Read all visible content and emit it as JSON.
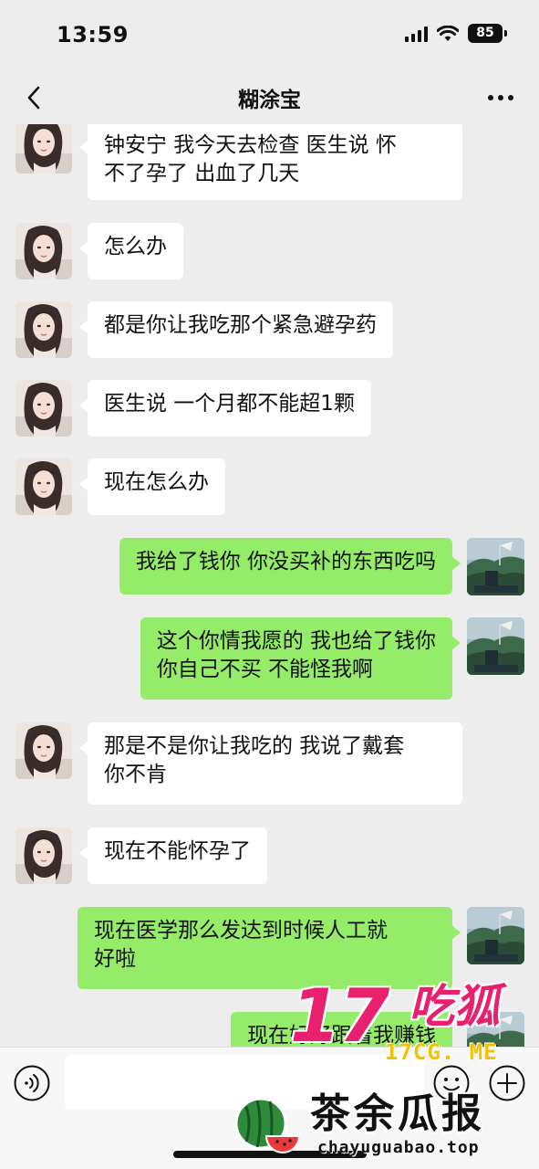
{
  "status_bar": {
    "time": "13:59",
    "battery": "85"
  },
  "chat": {
    "title": "糊涂宝"
  },
  "messages": [
    {
      "side": "left",
      "lines": [
        "钟安宁 我今天去检查 医生说 怀",
        "不了孕了 出血了几天"
      ]
    },
    {
      "side": "left",
      "lines": [
        "怎么办"
      ]
    },
    {
      "side": "left",
      "lines": [
        "都是你让我吃那个紧急避孕药"
      ]
    },
    {
      "side": "left",
      "lines": [
        "医生说 一个月都不能超1颗"
      ]
    },
    {
      "side": "left",
      "lines": [
        "现在怎么办"
      ]
    },
    {
      "side": "right",
      "lines": [
        "我给了钱你 你没买补的东西吃吗"
      ]
    },
    {
      "side": "right",
      "lines": [
        "这个你情我愿的 我也给了钱你",
        "你自己不买 不能怪我啊"
      ]
    },
    {
      "side": "left",
      "lines": [
        "那是不是你让我吃的 我说了戴套",
        "你不肯"
      ]
    },
    {
      "side": "left",
      "lines": [
        "现在不能怀孕了"
      ]
    },
    {
      "side": "right",
      "lines": [
        "现在医学那么发达到时候人工就",
        "好啦"
      ]
    },
    {
      "side": "right",
      "lines": [
        "现在好好跟着我赚钱"
      ]
    }
  ],
  "input_bar": {
    "placeholder": ""
  },
  "watermarks": {
    "top": {
      "number": "17",
      "name": "吃狐",
      "url": "17CG. ME"
    },
    "bottom": {
      "name": "茶余瓜报",
      "url": "chayuguabao.top"
    }
  },
  "colors": {
    "background": "#ededed",
    "bubble_sent": "#95ec69",
    "bubble_received": "#ffffff",
    "watermark_pink": "#e8206e",
    "watermark_yellow": "#f5c000"
  }
}
